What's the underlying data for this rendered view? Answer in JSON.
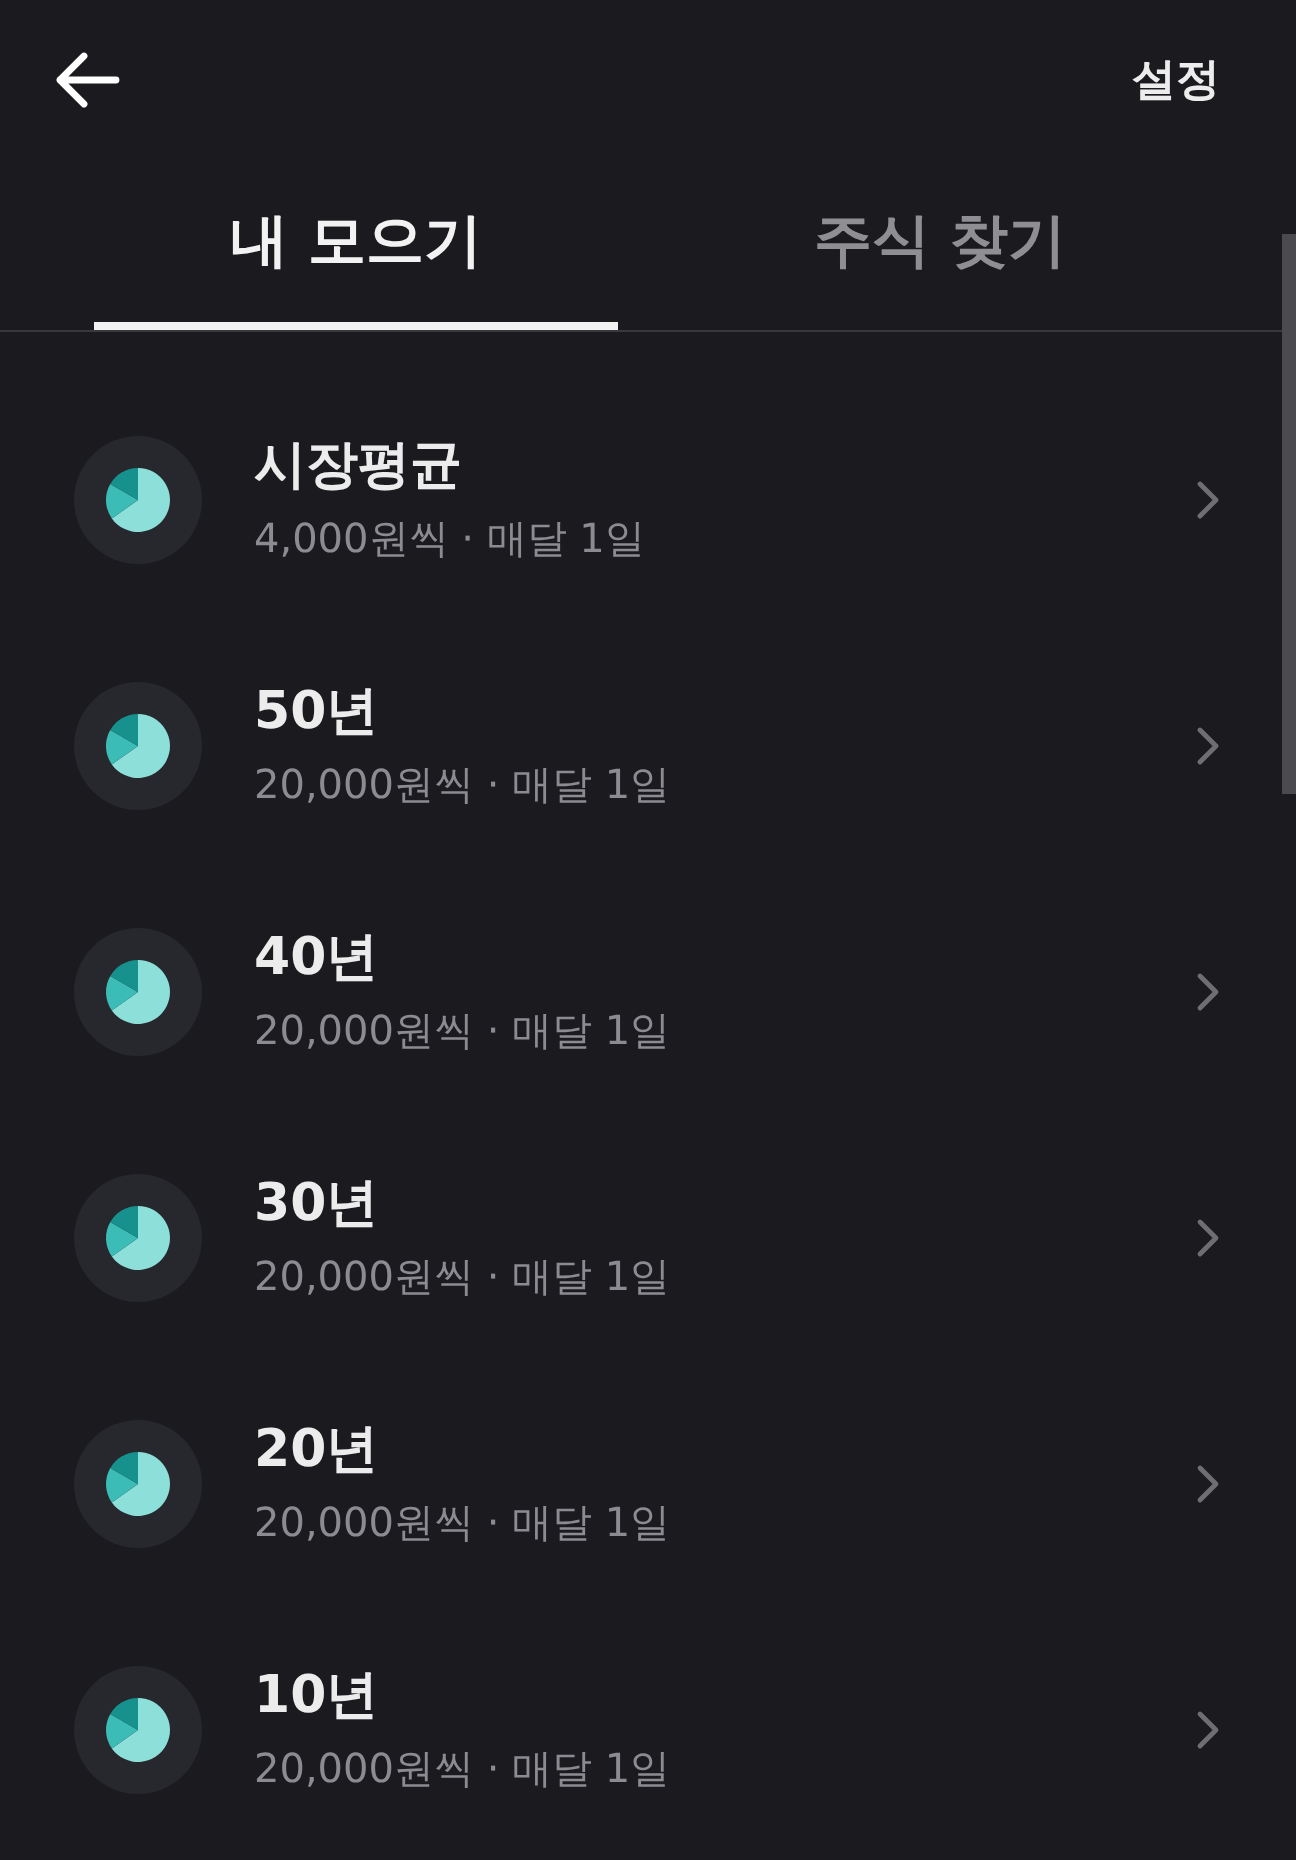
{
  "header": {
    "action": "설정"
  },
  "tabs": [
    {
      "label": "내 모으기",
      "selected": true
    },
    {
      "label": "주식 찾기",
      "selected": false
    }
  ],
  "plans": [
    {
      "title": "시장평균",
      "subtitle": "4,000원씩 · 매달 1일"
    },
    {
      "title": "50년",
      "subtitle": "20,000원씩 · 매달 1일"
    },
    {
      "title": "40년",
      "subtitle": "20,000원씩 · 매달 1일"
    },
    {
      "title": "30년",
      "subtitle": "20,000원씩 · 매달 1일"
    },
    {
      "title": "20년",
      "subtitle": "20,000원씩 · 매달 1일"
    },
    {
      "title": "10년",
      "subtitle": "20,000원씩 · 매달 1일"
    }
  ]
}
